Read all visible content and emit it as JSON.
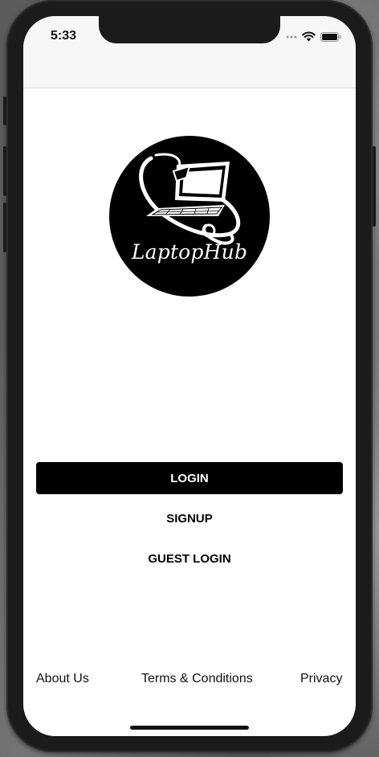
{
  "status_bar": {
    "time": "5:33",
    "icons": [
      "signal-dots-icon",
      "wifi-icon",
      "battery-icon"
    ]
  },
  "logo": {
    "brand_name": "LaptopHub",
    "icon": "laptop-globe-icon"
  },
  "buttons": {
    "login_label": "LOGIN",
    "signup_label": "SIGNUP",
    "guest_login_label": "GUEST LOGIN"
  },
  "footer": {
    "about_label": "About Us",
    "terms_label": "Terms & Conditions",
    "privacy_label": "Privacy"
  },
  "colors": {
    "primary_button": "#000000",
    "primary_button_text": "#ffffff",
    "screen_background": "#ffffff",
    "status_bar_background": "#f7f7f7"
  }
}
